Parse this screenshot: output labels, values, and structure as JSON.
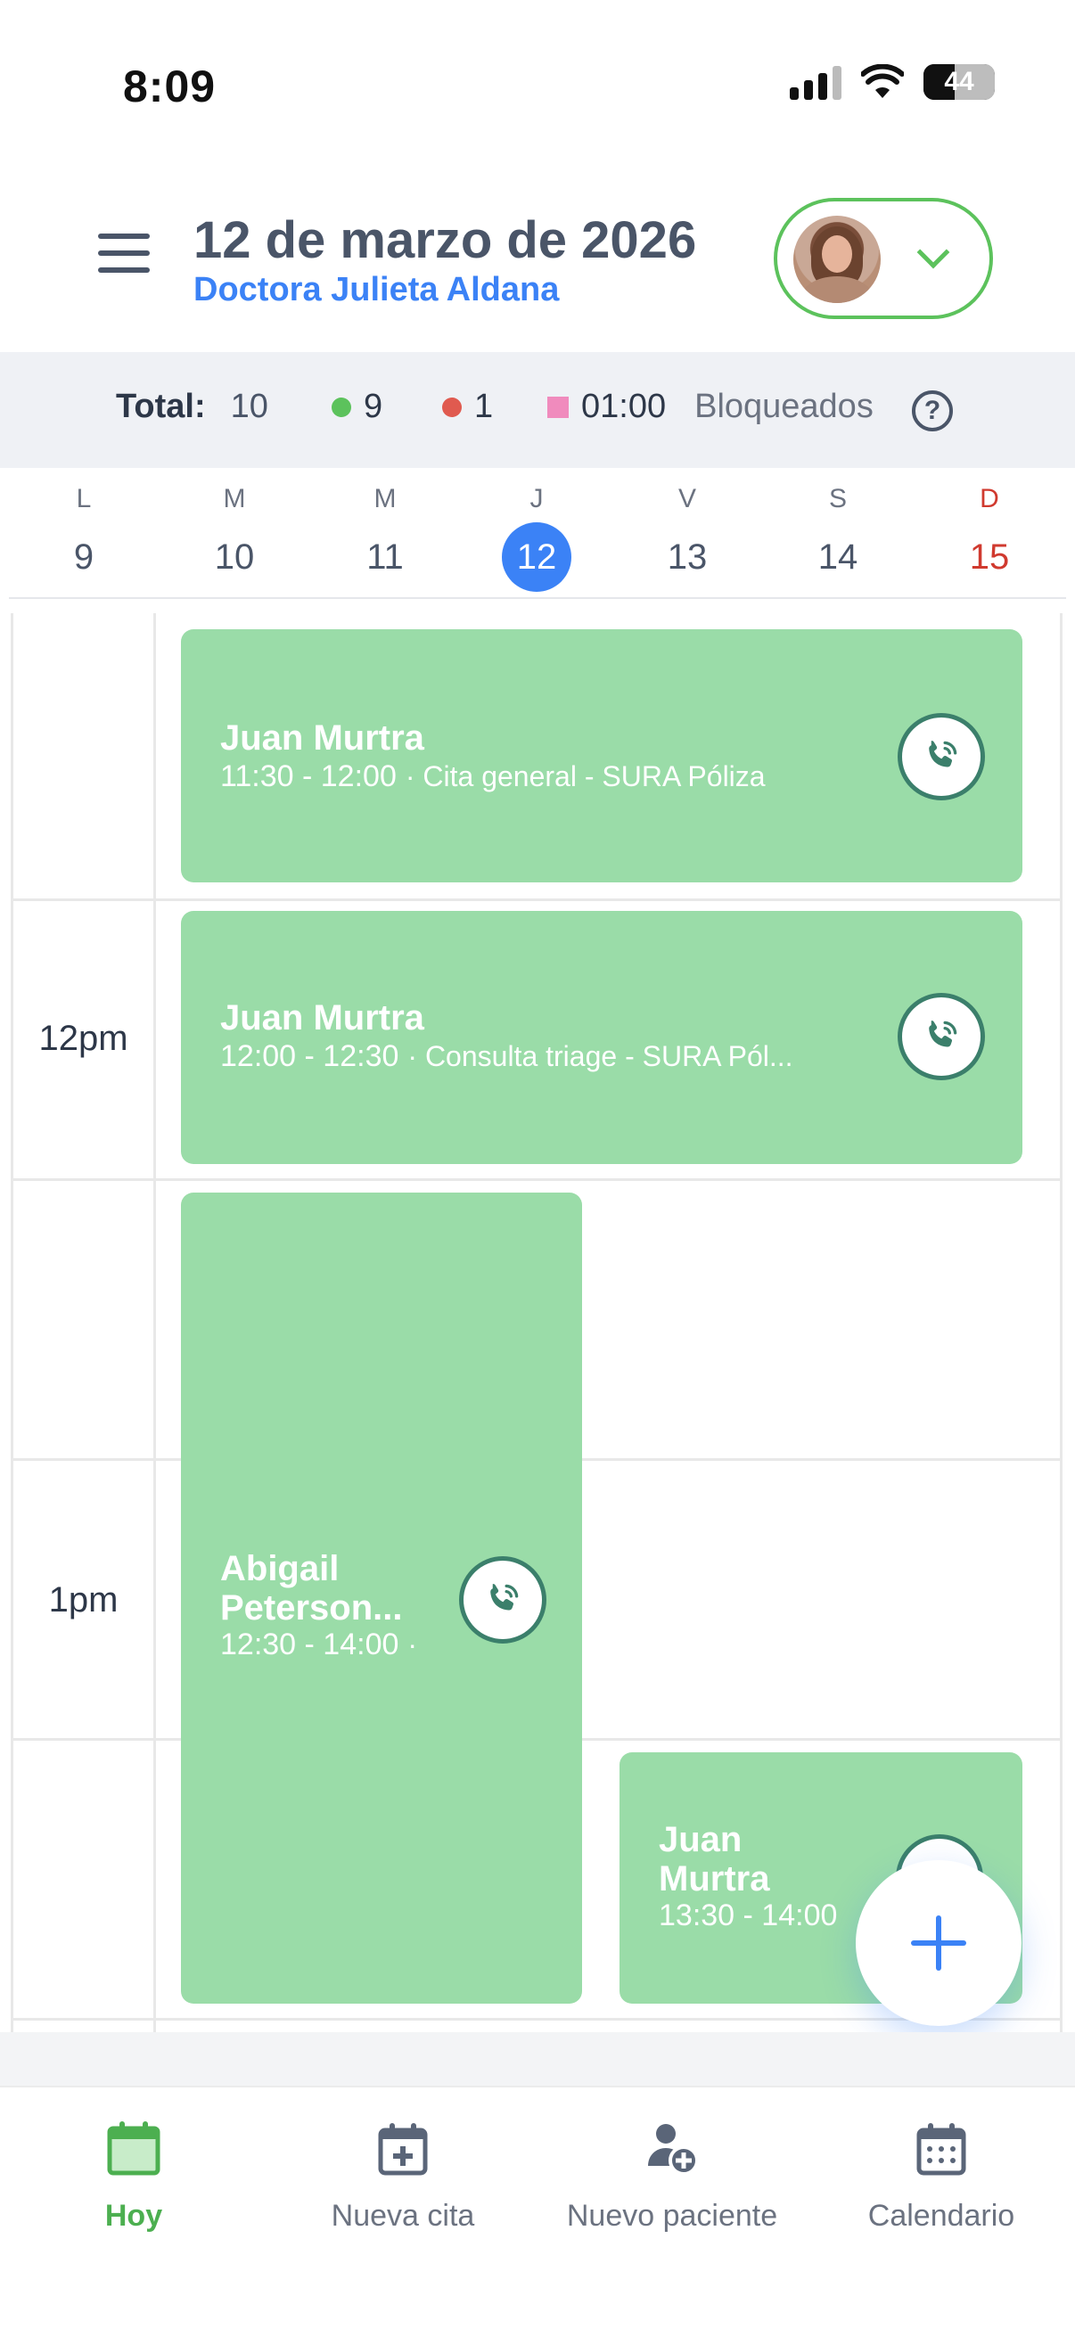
{
  "status_bar": {
    "time": "8:09",
    "battery": "44"
  },
  "header": {
    "date_title": "12 de marzo de 2026",
    "doctor_name": "Doctora Julieta Aldana"
  },
  "summary": {
    "total_label": "Total:",
    "total_value": "10",
    "green_count": "9",
    "red_count": "1",
    "blocked_time": "01:00",
    "blocked_label": "Bloqueados",
    "help": "?"
  },
  "week": [
    {
      "letter": "L",
      "num": "9"
    },
    {
      "letter": "M",
      "num": "10"
    },
    {
      "letter": "M",
      "num": "11"
    },
    {
      "letter": "J",
      "num": "12"
    },
    {
      "letter": "V",
      "num": "13"
    },
    {
      "letter": "S",
      "num": "14"
    },
    {
      "letter": "D",
      "num": "15"
    }
  ],
  "time_labels": {
    "t12": "12pm",
    "t1": "1pm"
  },
  "appointments": [
    {
      "name": "Juan Murtra",
      "time": "11:30 - 12:00",
      "desc": "· Cita general - SURA Póliza"
    },
    {
      "name": "Juan Murtra",
      "time": "12:00 - 12:30",
      "desc": "· Consulta triage - SURA Pól..."
    },
    {
      "name_line1": "Abigail",
      "name_line2": "Peterson...",
      "time": "12:30 - 14:00",
      "desc": "·"
    },
    {
      "name_line1": "Juan",
      "name_line2": "Murtra",
      "time": "13:30 - 14:00"
    }
  ],
  "nav": {
    "today": "Hoy",
    "new_appointment": "Nueva cita",
    "new_patient": "Nuevo paciente",
    "calendar": "Calendario"
  },
  "colors": {
    "accent": "#3b82f6",
    "appointment_green": "#9adca8",
    "status_green": "#5cc25c",
    "status_red": "#e05a4f",
    "blocked_pink": "#f08bbd",
    "sunday_red": "#d03a2f"
  }
}
